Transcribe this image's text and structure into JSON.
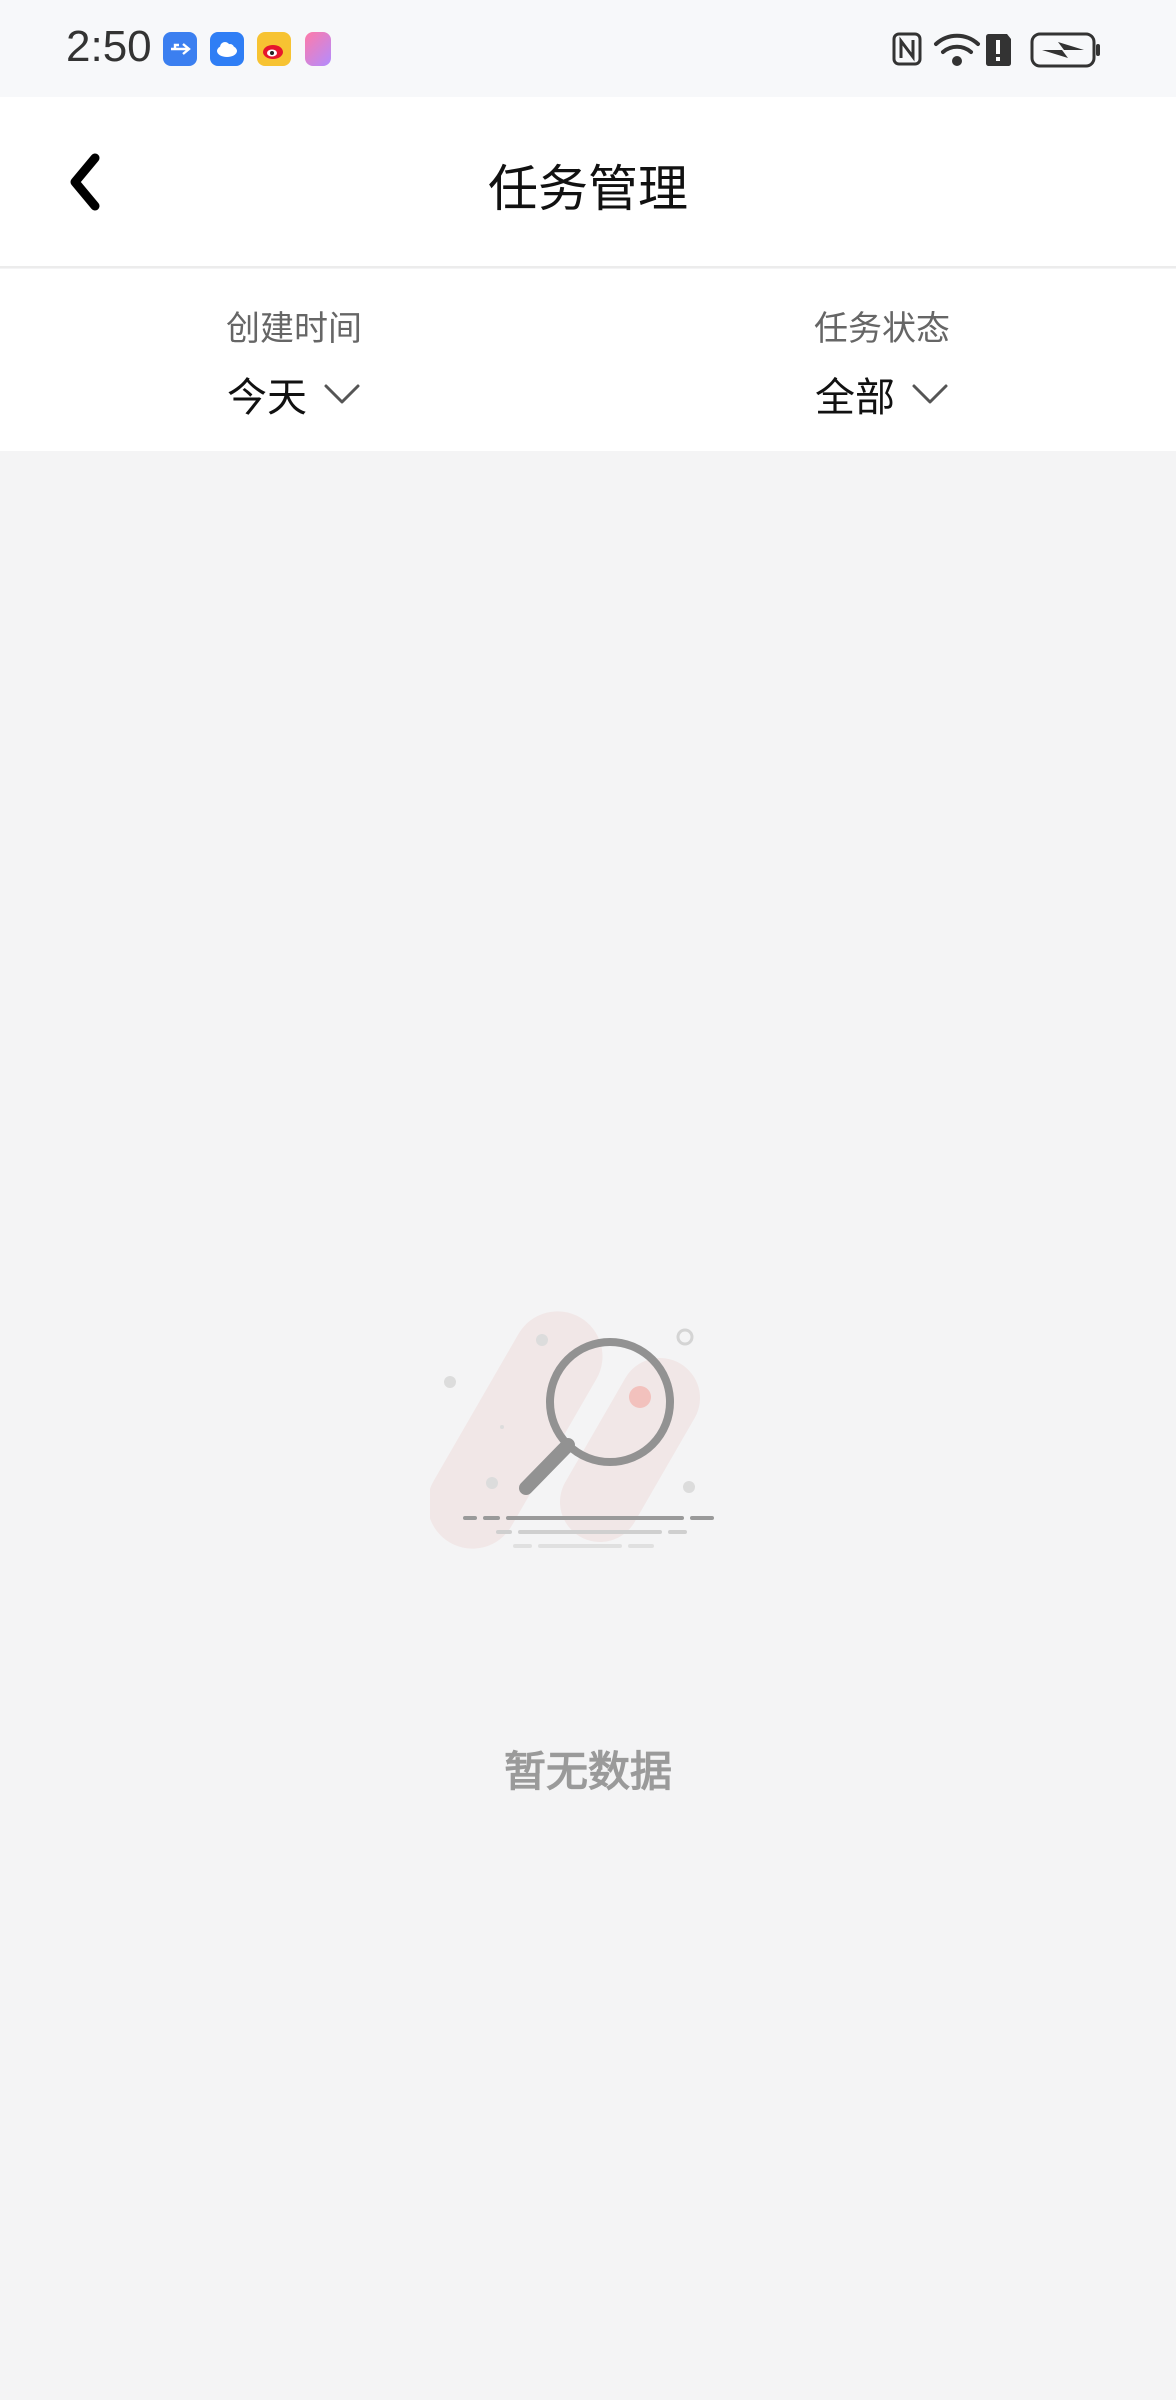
{
  "status_bar": {
    "time": "2:50",
    "left_icons": [
      "usb-icon",
      "cloud-icon",
      "weibo-icon",
      "app-icon"
    ],
    "right_icons": [
      "nfc-icon",
      "wifi-icon",
      "alert-icon",
      "battery-charging-icon"
    ]
  },
  "header": {
    "title": "任务管理",
    "back_icon": "chevron-left-icon"
  },
  "filters": {
    "created_time": {
      "label": "创建时间",
      "value": "今天"
    },
    "task_status": {
      "label": "任务状态",
      "value": "全部"
    }
  },
  "empty_state": {
    "text": "暂无数据",
    "illustration": "magnifier-empty-illustration"
  }
}
